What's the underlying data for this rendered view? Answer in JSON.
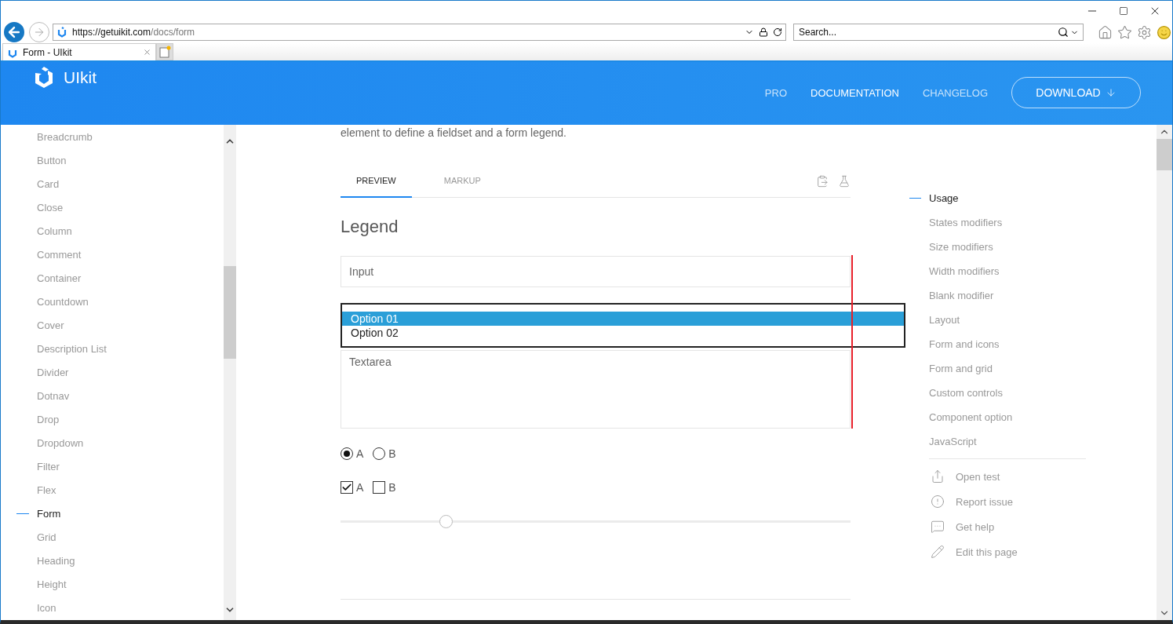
{
  "address_bar": {
    "url_host": "https://getuikit.com",
    "url_path": "/docs/form"
  },
  "search_box": {
    "placeholder": "Search..."
  },
  "browser_tabs": [
    {
      "title": "Form - UIkit",
      "selected": true
    }
  ],
  "site_header": {
    "logo_text": "UIkit",
    "nav": [
      {
        "label": "PRO",
        "selected": false
      },
      {
        "label": "DOCUMENTATION",
        "selected": true
      },
      {
        "label": "CHANGELOG",
        "selected": false
      }
    ],
    "download_button": "DOWNLOAD"
  },
  "sidebar": {
    "items": [
      {
        "label": "Breadcrumb",
        "selected": false
      },
      {
        "label": "Button",
        "selected": false
      },
      {
        "label": "Card",
        "selected": false
      },
      {
        "label": "Close",
        "selected": false
      },
      {
        "label": "Column",
        "selected": false
      },
      {
        "label": "Comment",
        "selected": false
      },
      {
        "label": "Container",
        "selected": false
      },
      {
        "label": "Countdown",
        "selected": false
      },
      {
        "label": "Cover",
        "selected": false
      },
      {
        "label": "Description List",
        "selected": false
      },
      {
        "label": "Divider",
        "selected": false
      },
      {
        "label": "Dotnav",
        "selected": false
      },
      {
        "label": "Drop",
        "selected": false
      },
      {
        "label": "Dropdown",
        "selected": false
      },
      {
        "label": "Filter",
        "selected": false
      },
      {
        "label": "Flex",
        "selected": false
      },
      {
        "label": "Form",
        "selected": true
      },
      {
        "label": "Grid",
        "selected": false
      },
      {
        "label": "Heading",
        "selected": false
      },
      {
        "label": "Height",
        "selected": false
      },
      {
        "label": "Icon",
        "selected": false
      }
    ]
  },
  "main": {
    "intro": "element to define a fieldset and a form legend.",
    "tabs": [
      {
        "label": "PREVIEW",
        "selected": true
      },
      {
        "label": "MARKUP",
        "selected": false
      }
    ],
    "legend": "Legend",
    "input": {
      "placeholder": "Input"
    },
    "select": {
      "options": [
        {
          "label": "Option 01",
          "selected": true
        },
        {
          "label": "Option 02",
          "selected": false
        }
      ]
    },
    "textarea": {
      "placeholder": "Textarea"
    },
    "radios": [
      {
        "label": "A",
        "checked": true
      },
      {
        "label": "B",
        "checked": false
      }
    ],
    "checkboxes": [
      {
        "label": "A",
        "checked": true
      },
      {
        "label": "B",
        "checked": false
      }
    ],
    "range": {
      "level": 0.206
    }
  },
  "right_nav": {
    "items": [
      {
        "label": "Usage",
        "selected": true
      },
      {
        "label": "States modifiers",
        "selected": false
      },
      {
        "label": "Size modifiers",
        "selected": false
      },
      {
        "label": "Width modifiers",
        "selected": false
      },
      {
        "label": "Blank modifier",
        "selected": false
      },
      {
        "label": "Layout",
        "selected": false
      },
      {
        "label": "Form and icons",
        "selected": false
      },
      {
        "label": "Form and grid",
        "selected": false
      },
      {
        "label": "Custom controls",
        "selected": false
      },
      {
        "label": "Component option",
        "selected": false
      },
      {
        "label": "JavaScript",
        "selected": false
      }
    ],
    "links": [
      {
        "label": "Open test",
        "kind": "share"
      },
      {
        "label": "Report issue",
        "kind": "alert"
      },
      {
        "label": "Get help",
        "kind": "chat"
      },
      {
        "label": "Edit this page",
        "kind": "edit"
      }
    ]
  }
}
